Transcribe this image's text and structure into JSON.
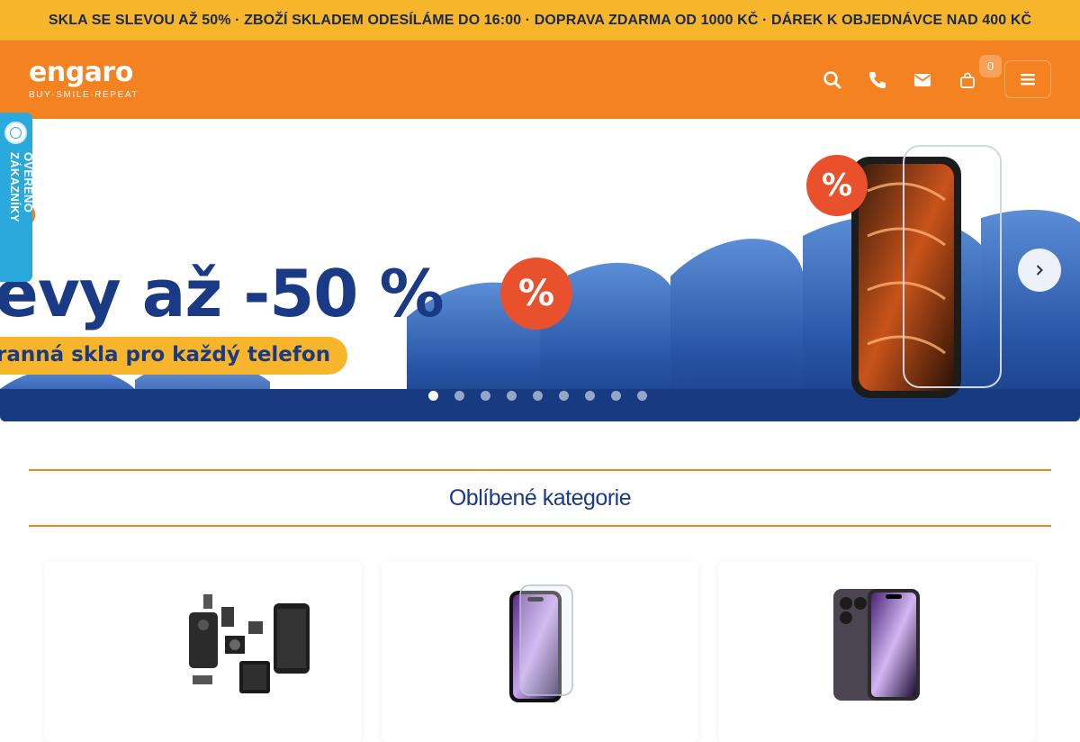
{
  "announcement": "SKLA SE SLEVOU AŽ 50% · ZBOŽÍ SKLADEM ODESÍLÁME DO 16:00 · DOPRAVA ZDARMA OD 1000 KČ · DÁREK K OBJEDNÁVCE NAD 400 KČ",
  "header": {
    "logo": "engaro",
    "tagline": "BUY·SMILE·REPEAT",
    "cart_count": "0",
    "icons": [
      "search-icon",
      "phone-icon",
      "envelope-icon",
      "shopping-bag-icon",
      "hamburger-menu-icon"
    ]
  },
  "trust_badge": "OVĚŘENO ZÁKAZNÍKY",
  "hero": {
    "line1": "ro",
    "line2": "evy až -50 %",
    "line3": "ranná skla pro každý telefon",
    "percent_symbol": "%",
    "slide_count": 9,
    "active_slide": 1
  },
  "section": {
    "title": "Oblíbené kategorie"
  },
  "categories": [
    {
      "image": "phone-spare-parts"
    },
    {
      "image": "tempered-glass-protector"
    },
    {
      "image": "protective-film"
    }
  ],
  "colors": {
    "topbar": "#f7b52c",
    "header": "#f58220",
    "navy": "#1a3a86",
    "trust_badge": "#2aa9dc"
  }
}
